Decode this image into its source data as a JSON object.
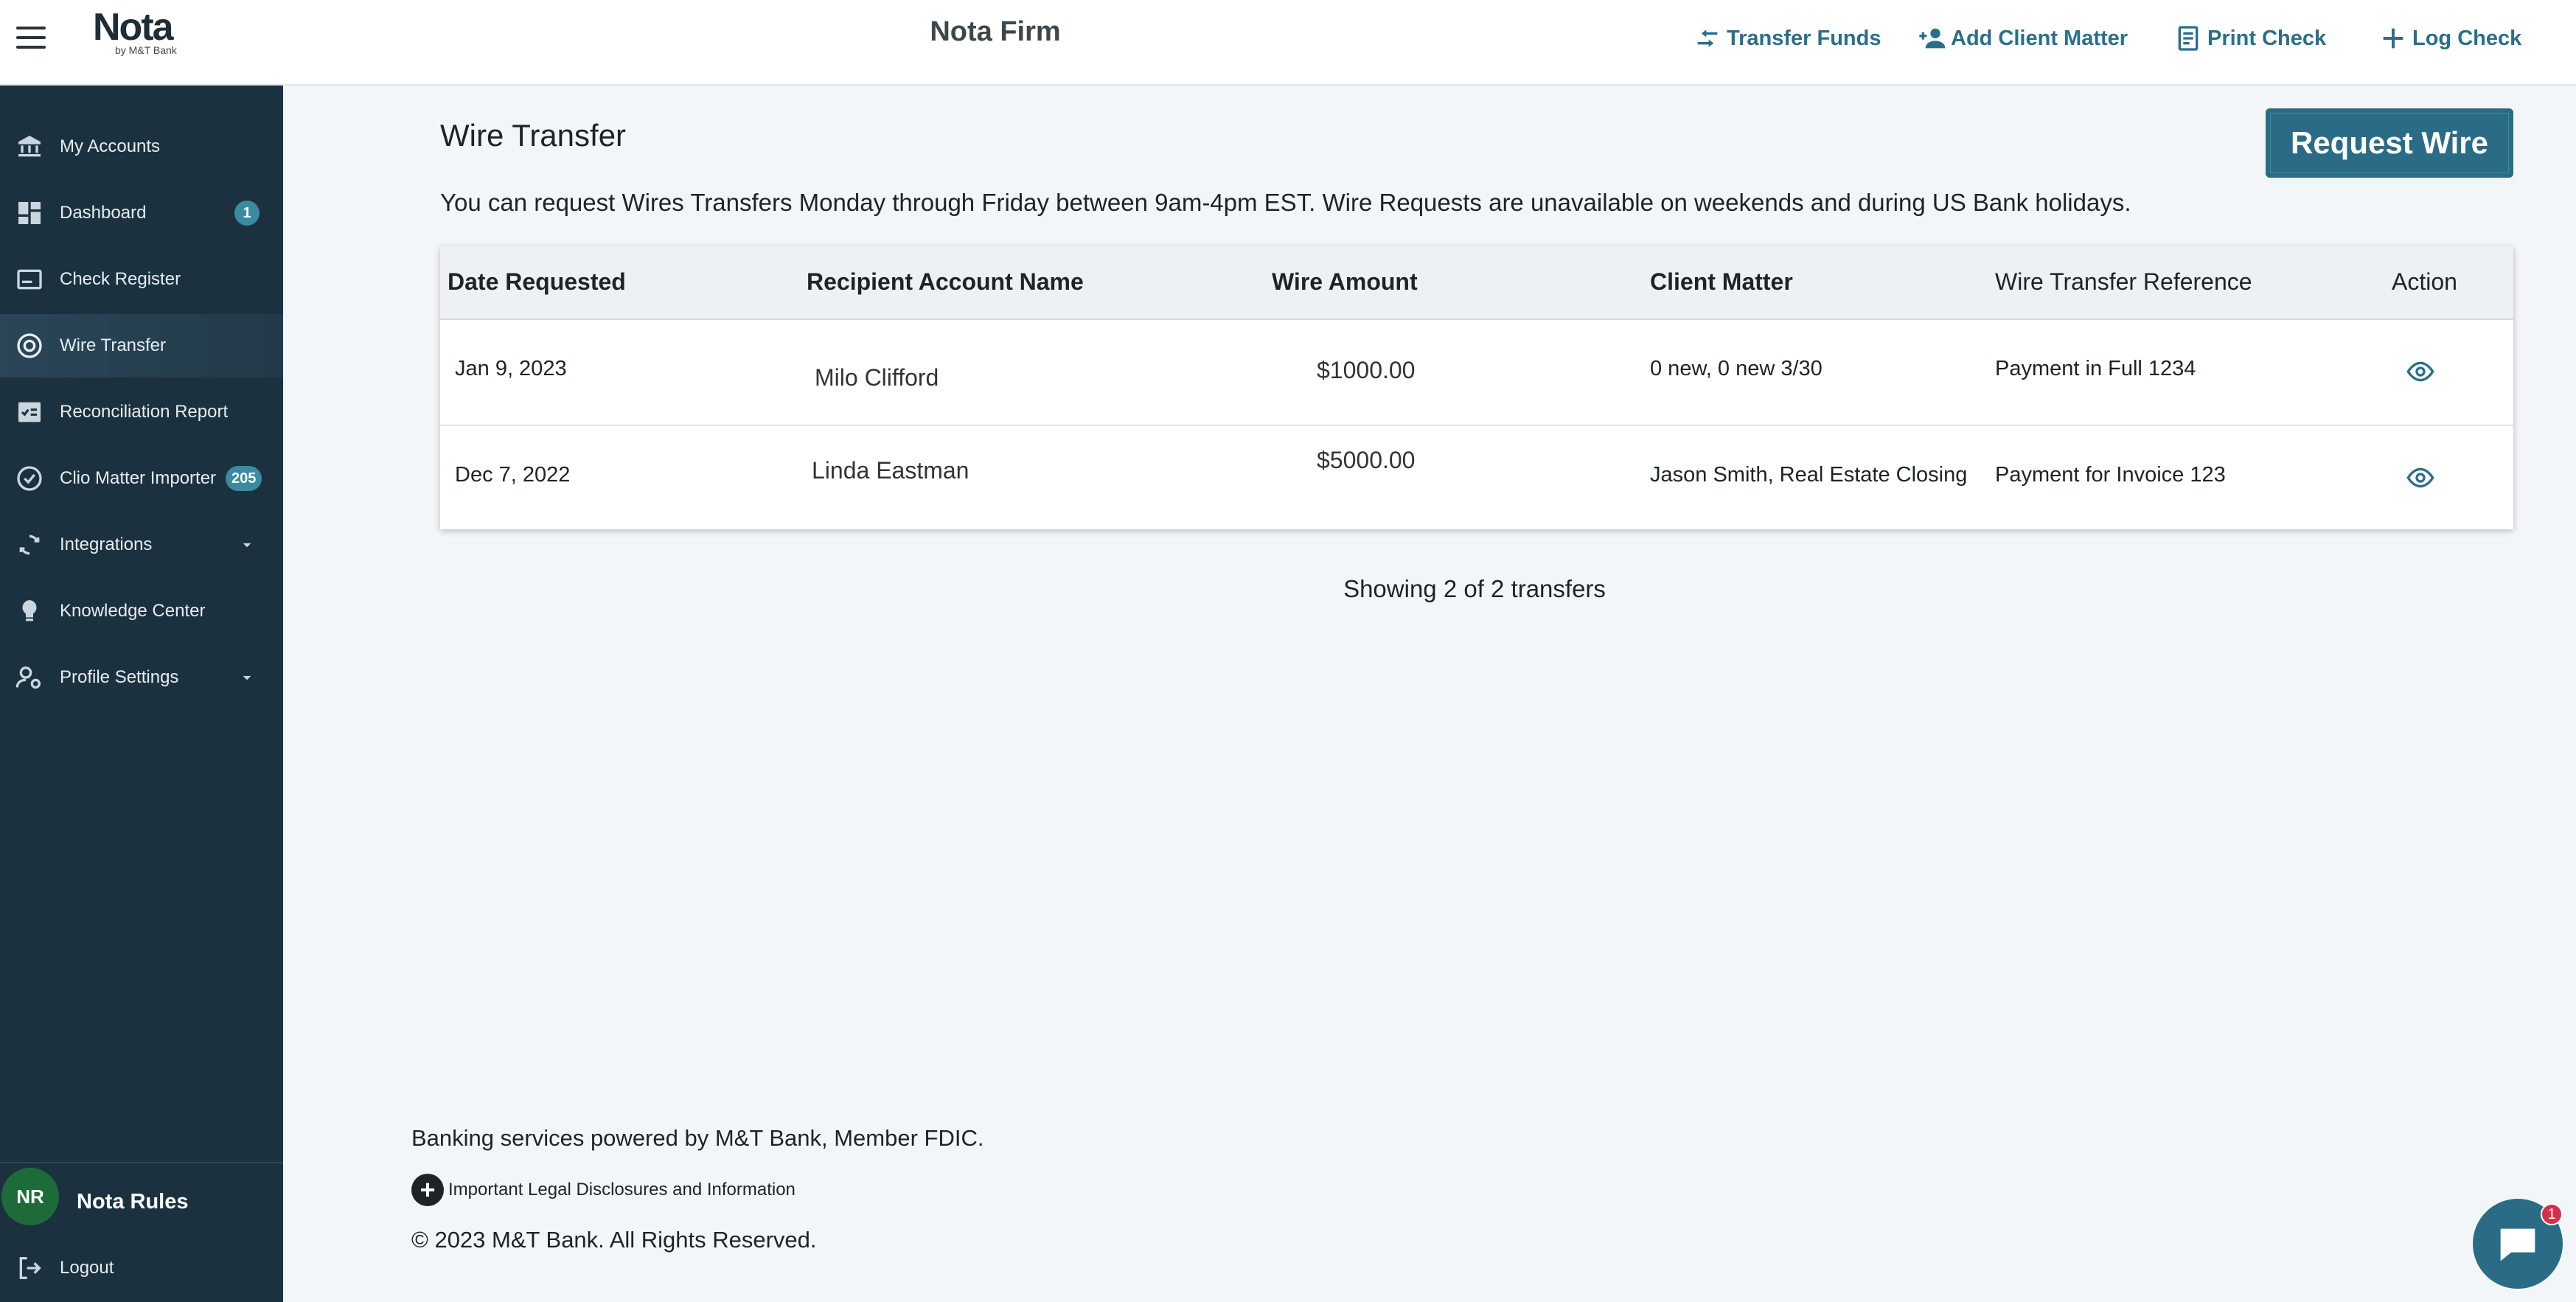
{
  "header": {
    "logo_text": "Nota",
    "logo_sub": "by M&T Bank",
    "title": "Nota Firm",
    "actions": [
      {
        "label": "Transfer Funds",
        "icon": "transfer-icon"
      },
      {
        "label": "Add Client Matter",
        "icon": "add-person-icon"
      },
      {
        "label": "Print Check",
        "icon": "print-check-icon"
      },
      {
        "label": "Log Check",
        "icon": "plus-icon"
      }
    ]
  },
  "sidebar": {
    "items": [
      {
        "label": "My Accounts",
        "icon": "bank-icon"
      },
      {
        "label": "Dashboard",
        "icon": "dashboard-icon",
        "badge": "1"
      },
      {
        "label": "Check Register",
        "icon": "check-register-icon"
      },
      {
        "label": "Wire Transfer",
        "icon": "wire-transfer-icon",
        "active": true
      },
      {
        "label": "Reconciliation Report",
        "icon": "report-icon"
      },
      {
        "label": "Clio Matter Importer",
        "icon": "check-circle-icon",
        "badge": "205"
      },
      {
        "label": "Integrations",
        "icon": "sync-icon",
        "expandable": true
      },
      {
        "label": "Knowledge Center",
        "icon": "lightbulb-icon"
      },
      {
        "label": "Profile Settings",
        "icon": "person-settings-icon",
        "expandable": true
      }
    ],
    "user": {
      "initials": "NR",
      "name": "Nota Rules"
    },
    "logout_label": "Logout"
  },
  "main": {
    "title": "Wire Transfer",
    "request_button": "Request Wire",
    "notice": "You can request Wires Transfers Monday through Friday between 9am-4pm EST. Wire Requests are unavailable on weekends and during US Bank holidays.",
    "table": {
      "columns": [
        "Date Requested",
        "Recipient Account Name",
        "Wire Amount",
        "Client Matter",
        "Wire Transfer Reference",
        "Action"
      ],
      "rows": [
        {
          "date": "Jan 9, 2023",
          "recipient": "Milo Clifford",
          "amount": "$1000.00",
          "matter": "0 new, 0 new 3/30",
          "reference": "Payment in Full 1234",
          "action_icon": "eye-icon"
        },
        {
          "date": "Dec 7, 2022",
          "recipient": "Linda Eastman",
          "amount": "$5000.00",
          "matter": "Jason Smith, Real Estate Closing",
          "reference": "Payment for Invoice 123",
          "action_icon": "eye-icon"
        }
      ]
    },
    "showing": "Showing 2 of 2 transfers"
  },
  "footer": {
    "powered_by": "Banking services powered by M&T Bank, Member FDIC.",
    "legal_link": "Important Legal Disclosures and Information",
    "copyright": "© 2023 M&T Bank. All Rights Reserved."
  },
  "chat": {
    "badge": "1",
    "icon": "chat-icon"
  },
  "colors": {
    "sidebar_bg": "#1c3140",
    "accent": "#2a6c85",
    "badge": "#3a8aa0",
    "avatar": "#1e6b3a",
    "alert": "#d62f4b"
  }
}
